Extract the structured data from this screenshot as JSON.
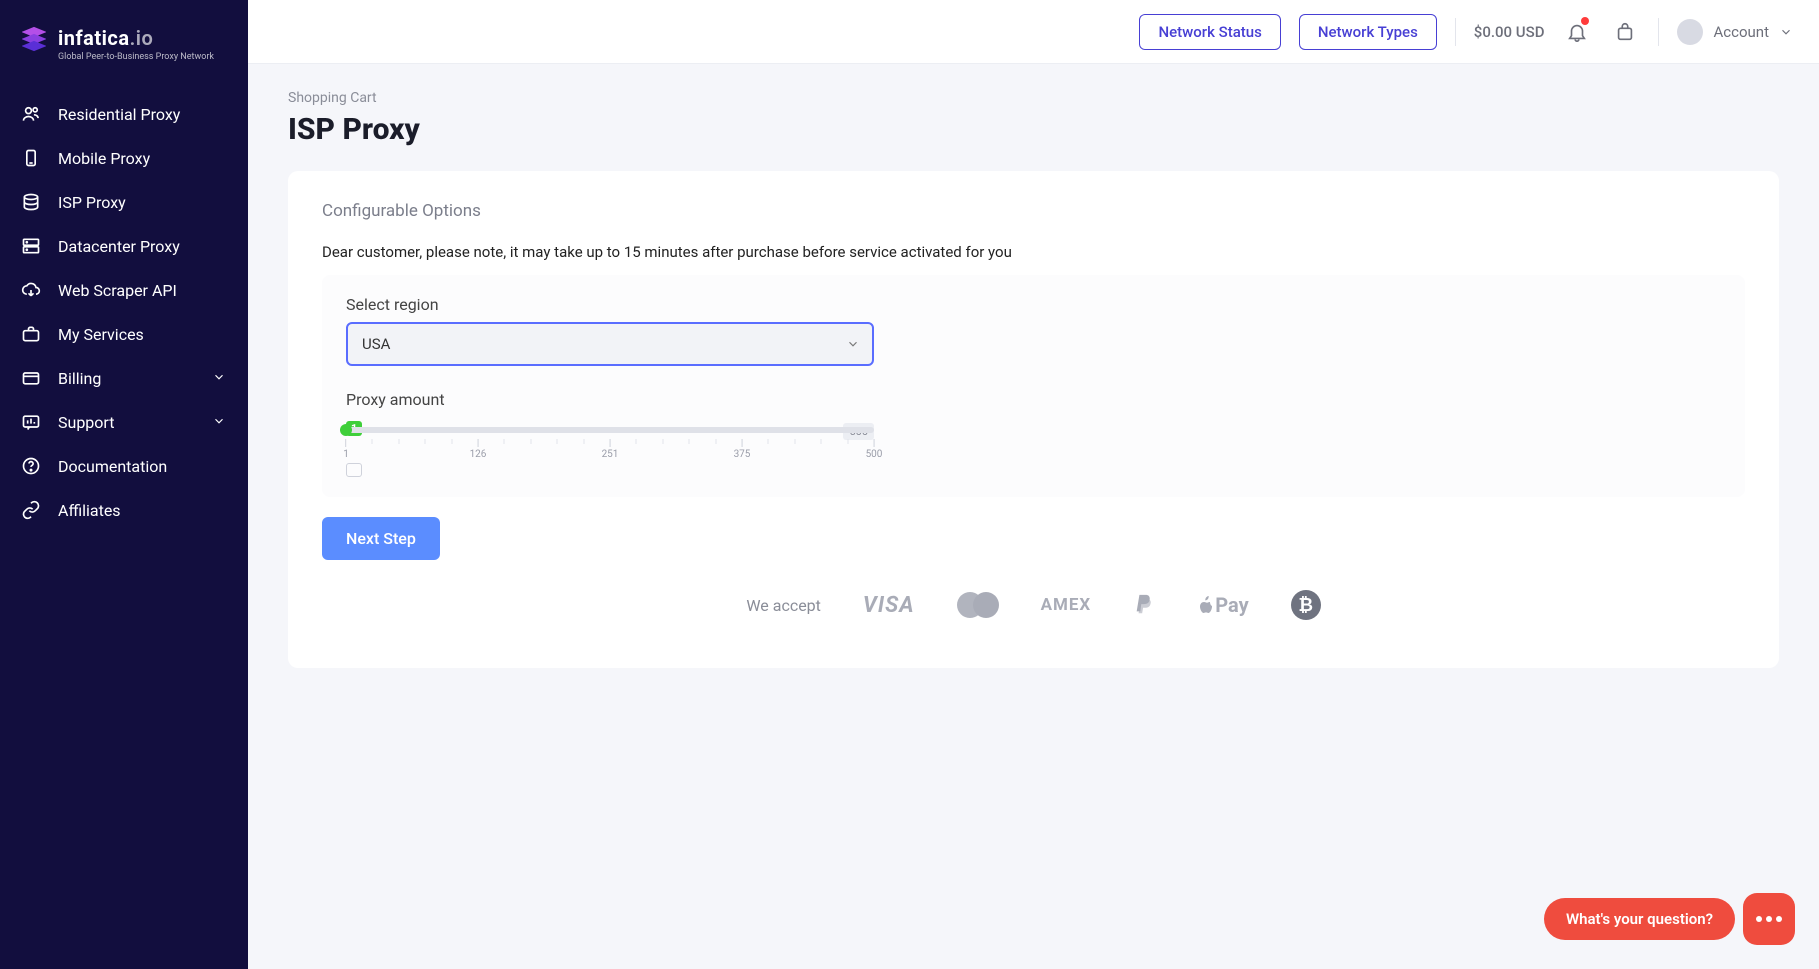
{
  "brand": {
    "name": "infatica",
    "suffix": ".io",
    "tagline": "Global Peer-to-Business Proxy Network"
  },
  "header": {
    "network_status": "Network Status",
    "network_types": "Network Types",
    "balance": "$0.00 USD",
    "account": "Account"
  },
  "sidebar": {
    "items": [
      {
        "label": "Residential Proxy"
      },
      {
        "label": "Mobile Proxy"
      },
      {
        "label": "ISP Proxy"
      },
      {
        "label": "Datacenter Proxy"
      },
      {
        "label": "Web Scraper API"
      },
      {
        "label": "My Services"
      },
      {
        "label": "Billing"
      },
      {
        "label": "Support"
      },
      {
        "label": "Documentation"
      },
      {
        "label": "Affiliates"
      }
    ]
  },
  "page": {
    "breadcrumb": "Shopping Cart",
    "title": "ISP Proxy"
  },
  "card": {
    "section": "Configurable Options",
    "note": "Dear customer, please note, it may take up to 15 minutes after purchase before service activated for you",
    "region_label": "Select region",
    "region_value": "USA",
    "amount_label": "Proxy amount",
    "amount_value": "1",
    "amount_max": "500",
    "ticks": [
      "1",
      "126",
      "251",
      "375",
      "500"
    ],
    "next": "Next Step"
  },
  "accept": {
    "label": "We accept",
    "visa": "VISA",
    "amex": "AMEX",
    "applepay": "Pay",
    "btc": "₿"
  },
  "chat": {
    "prompt": "What's your question?"
  }
}
